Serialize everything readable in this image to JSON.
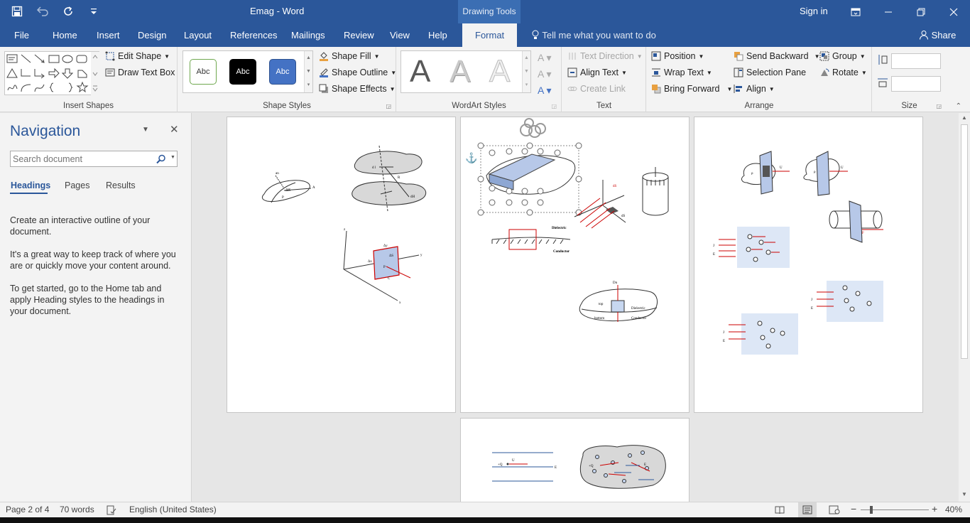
{
  "window": {
    "title": "Emag  -  Word",
    "context_tab": "Drawing Tools",
    "sign_in": "Sign in",
    "share": "Share",
    "tell_me": "Tell me what you want to do"
  },
  "tabs": [
    "File",
    "Home",
    "Insert",
    "Design",
    "Layout",
    "References",
    "Mailings",
    "Review",
    "View",
    "Help",
    "Format"
  ],
  "active_tab": "Format",
  "ribbon": {
    "insert_shapes": {
      "label": "Insert Shapes",
      "edit_shape": "Edit Shape",
      "draw_text_box": "Draw Text Box"
    },
    "shape_styles": {
      "label": "Shape Styles",
      "gallery": [
        "Abc",
        "Abc",
        "Abc"
      ],
      "shape_fill": "Shape Fill",
      "shape_outline": "Shape Outline",
      "shape_effects": "Shape Effects"
    },
    "wordart_styles": {
      "label": "WordArt Styles",
      "letters": [
        "A",
        "A",
        "A"
      ]
    },
    "text": {
      "label": "Text",
      "text_direction": "Text Direction",
      "align_text": "Align Text",
      "create_link": "Create Link"
    },
    "arrange": {
      "label": "Arrange",
      "position": "Position",
      "wrap_text": "Wrap Text",
      "bring_forward": "Bring Forward",
      "send_backward": "Send Backward",
      "selection_pane": "Selection Pane",
      "align": "Align",
      "group": "Group",
      "rotate": "Rotate"
    },
    "size": {
      "label": "Size",
      "height": "",
      "width": ""
    }
  },
  "navigation": {
    "title": "Navigation",
    "search_placeholder": "Search document",
    "tabs": [
      "Headings",
      "Pages",
      "Results"
    ],
    "active_tab": "Headings",
    "paragraphs": [
      "Create an interactive outline of your document.",
      "It's a great way to keep track of where you are or quickly move your content around.",
      "To get started, go to the Home tab and apply Heading styles to the headings in your document."
    ]
  },
  "figures": {
    "p1_labels": [
      "ΔS",
      "P",
      "d l",
      "R",
      "dH",
      "Δy",
      "ΔS",
      "Δx",
      "P",
      "C",
      "z",
      "y",
      "x",
      "an"
    ],
    "p2_labels": [
      "Dielectric",
      "Conductor",
      "dS",
      "dS",
      "Dn",
      "top",
      "bottom",
      "Dielectric",
      "Conductor"
    ],
    "p3_labels": [
      "ρ",
      "U",
      "ρ",
      "U",
      "J",
      "E",
      "J",
      "E",
      "J",
      "E",
      "F"
    ],
    "p4_labels": [
      "+Q",
      "U",
      "E",
      "+Q",
      "E"
    ]
  },
  "status": {
    "page": "Page 2 of 4",
    "words": "70 words",
    "language": "English (United States)",
    "zoom": "40%"
  }
}
